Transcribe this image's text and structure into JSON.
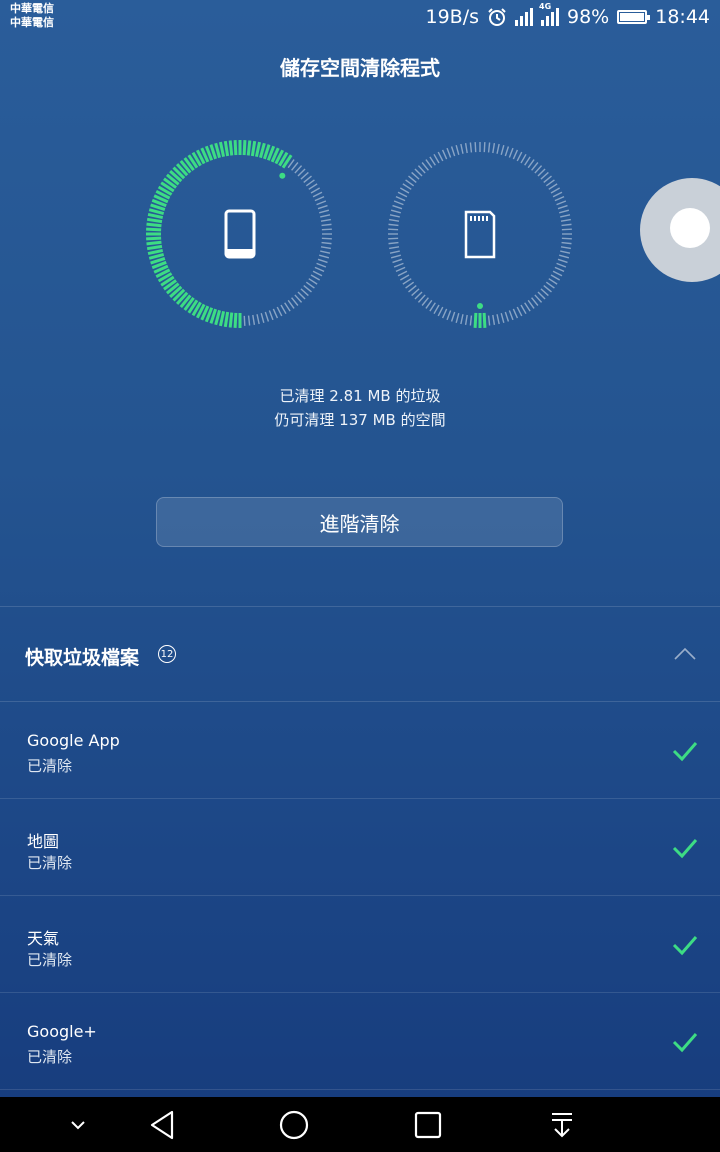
{
  "status_bar": {
    "carrier_1": "中華電信",
    "carrier_2": "中華電信",
    "net_speed": "19B/s",
    "network_type": "4G",
    "battery": "98%",
    "battery_level": 0.98,
    "time": "18:44",
    "icons": [
      "alarm-icon",
      "signal-icon",
      "signal-4g-icon",
      "battery-icon"
    ]
  },
  "header": {
    "title": "儲存空間清除程式"
  },
  "gauges": {
    "internal": {
      "icon": "phone-icon",
      "level": 0.6
    },
    "sd_card": {
      "icon": "sd-card-icon",
      "level": 0.03
    },
    "active_color": "#3ddc84",
    "inactive_color": "#a9bdd6"
  },
  "summary": {
    "cleaned": "已清理 2.81 MB 的垃圾",
    "can_clean": "仍可清理 137 MB 的空間"
  },
  "advanced_button": {
    "label": "進階清除"
  },
  "cache_section": {
    "title": "快取垃圾檔案",
    "count": "12",
    "items": [
      {
        "name": "Google App",
        "status": "已清除"
      },
      {
        "name": "地圖",
        "status": "已清除"
      },
      {
        "name": "天氣",
        "status": "已清除"
      },
      {
        "name": "Google+",
        "status": "已清除"
      }
    ]
  },
  "nav_bar": {
    "icons": [
      "chevron-down-icon",
      "back-icon",
      "home-icon",
      "recents-icon",
      "notification-pull-icon"
    ]
  },
  "colors": {
    "check": "#3ddc84",
    "background": "#245490"
  }
}
